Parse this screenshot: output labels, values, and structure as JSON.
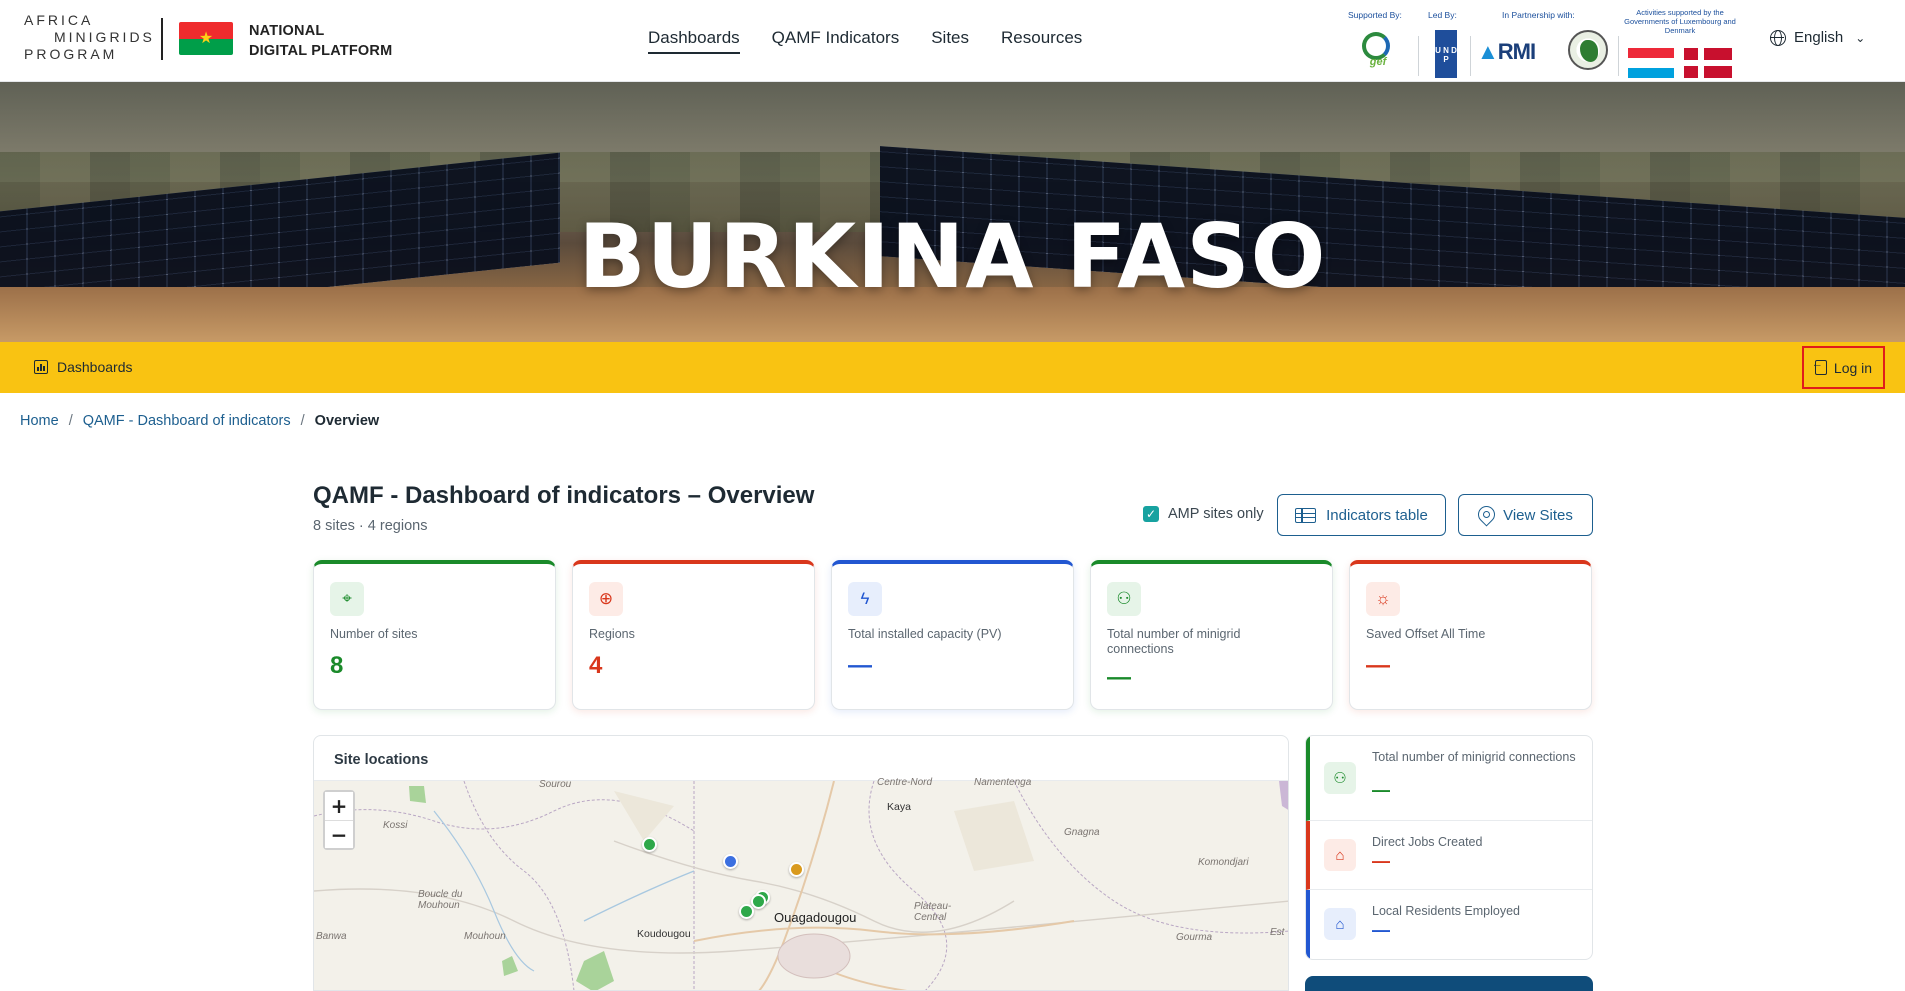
{
  "header": {
    "logo_lines": [
      "AFRICA",
      "MINIGRIDS",
      "PROGRAM"
    ],
    "platform_line1": "NATIONAL",
    "platform_line2": "DIGITAL PLATFORM",
    "nav": [
      {
        "label": "Dashboards",
        "active": true
      },
      {
        "label": "QAMF Indicators",
        "active": false
      },
      {
        "label": "Sites",
        "active": false
      },
      {
        "label": "Resources",
        "active": false
      }
    ],
    "partners": {
      "supported_by": "Supported By:",
      "led_by": "Led By:",
      "partnership": "In Partnership with:",
      "activities": "Activities supported by the Governments of Luxembourg and Denmark",
      "gef": "gef",
      "undp": "U N D P",
      "rmi": "RMI"
    },
    "language": "English"
  },
  "hero": {
    "title": "BURKINA FASO"
  },
  "subbar": {
    "dashboards_label": "Dashboards",
    "login_label": "Log in"
  },
  "breadcrumb": {
    "home": "Home",
    "parent": "QAMF - Dashboard of indicators",
    "current": "Overview",
    "separator": "/"
  },
  "page": {
    "title": "QAMF - Dashboard of indicators – Overview",
    "subtitle": "8 sites · 4 regions",
    "amp_only_label": "AMP sites only",
    "amp_only_checked": true,
    "indicators_table_label": "Indicators table",
    "view_sites_label": "View Sites"
  },
  "kpis": [
    {
      "label": "Number of sites",
      "value": "8",
      "color": "#1a8a2a",
      "icon": "map-pin-icon"
    },
    {
      "label": "Regions",
      "value": "4",
      "color": "#d9371c",
      "icon": "globe-icon"
    },
    {
      "label": "Total installed capacity (PV)",
      "value": "—",
      "color": "#2257d1",
      "icon": "lightning-icon"
    },
    {
      "label": "Total number of minigrid connections",
      "value": "—",
      "color": "#1a8a2a",
      "icon": "users-icon"
    },
    {
      "label": "Saved Offset All Time",
      "value": "—",
      "color": "#d9371c",
      "icon": "sun-icon"
    }
  ],
  "map": {
    "title": "Site locations",
    "zoom_in": "+",
    "zoom_out": "−",
    "places": {
      "sourou": "Sourou",
      "centre_nord": "Centre-Nord",
      "namentenga": "Namentenga",
      "kaya": "Kaya",
      "kossi": "Kossi",
      "gnagna": "Gnagna",
      "komondjari": "Komondjari",
      "boucle1": "Boucle du",
      "boucle2": "Mouhoun",
      "plateau1": "Plateau-",
      "plateau2": "Central",
      "ouaga": "Ouagadougou",
      "banwa": "Banwa",
      "mouhoun": "Mouhoun",
      "koudougou": "Koudougou",
      "gourma": "Gourma",
      "est": "Est"
    }
  },
  "side_stats": [
    {
      "label": "Total number of minigrid connections",
      "value": "—",
      "color": "#1a8a2a",
      "icon": "users-icon"
    },
    {
      "label": "Direct Jobs Created",
      "value": "—",
      "color": "#d9371c",
      "icon": "graduation-cap-icon"
    },
    {
      "label": "Local Residents Employed",
      "value": "—",
      "color": "#2257d1",
      "icon": "home-icon"
    }
  ]
}
